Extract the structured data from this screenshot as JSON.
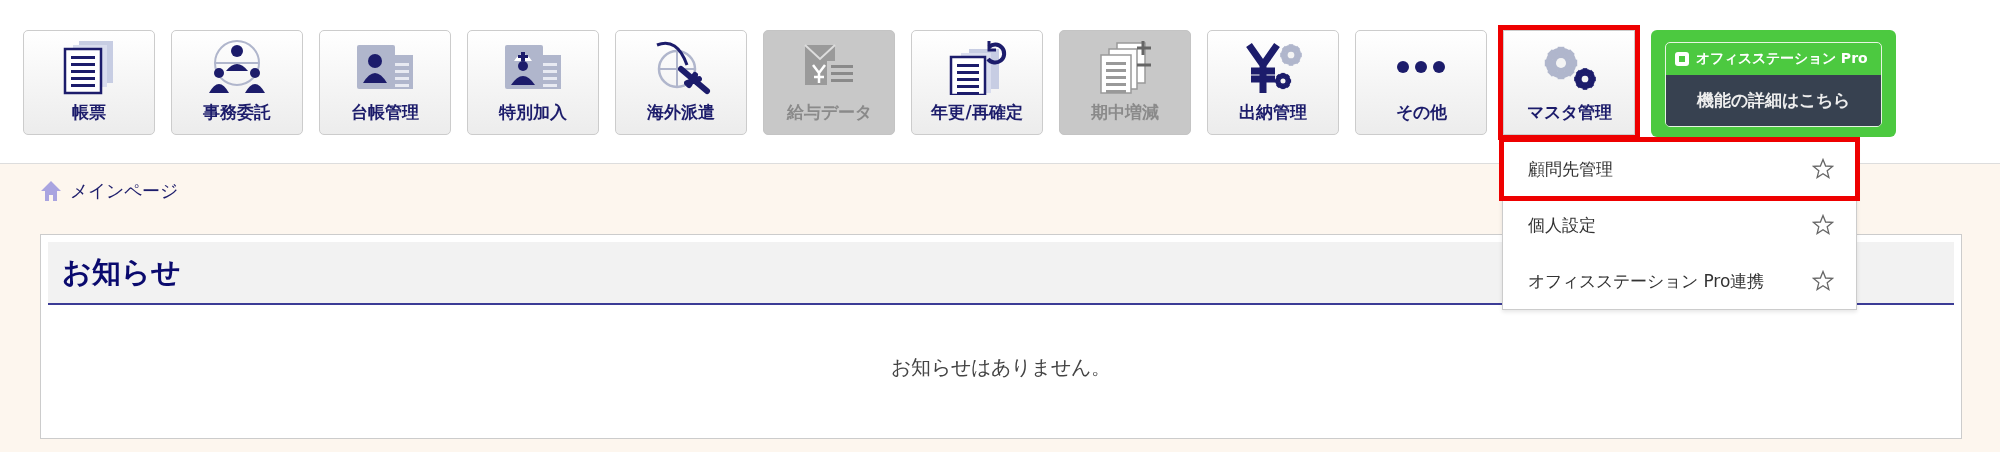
{
  "toolbar": [
    {
      "label": "帳票",
      "disabled": false,
      "highlighted": false
    },
    {
      "label": "事務委託",
      "disabled": false,
      "highlighted": false
    },
    {
      "label": "台帳管理",
      "disabled": false,
      "highlighted": false
    },
    {
      "label": "特別加入",
      "disabled": false,
      "highlighted": false
    },
    {
      "label": "海外派遣",
      "disabled": false,
      "highlighted": false
    },
    {
      "label": "給与データ",
      "disabled": true,
      "highlighted": false
    },
    {
      "label": "年更/再確定",
      "disabled": false,
      "highlighted": false
    },
    {
      "label": "期中増減",
      "disabled": true,
      "highlighted": false
    },
    {
      "label": "出納管理",
      "disabled": false,
      "highlighted": false
    },
    {
      "label": "その他",
      "disabled": false,
      "highlighted": false
    },
    {
      "label": "マスタ管理",
      "disabled": false,
      "highlighted": true
    }
  ],
  "pro_banner": {
    "brand": "オフィスステーション Pro",
    "label": "機能の詳細はこちら"
  },
  "dropdown": [
    {
      "label": "顧問先管理",
      "highlighted": true
    },
    {
      "label": "個人設定",
      "highlighted": false
    },
    {
      "label": "オフィスステーション Pro連携",
      "highlighted": false
    }
  ],
  "breadcrumb": "メインページ",
  "notice": {
    "title": "お知らせ",
    "message": "お知らせはありません。"
  }
}
